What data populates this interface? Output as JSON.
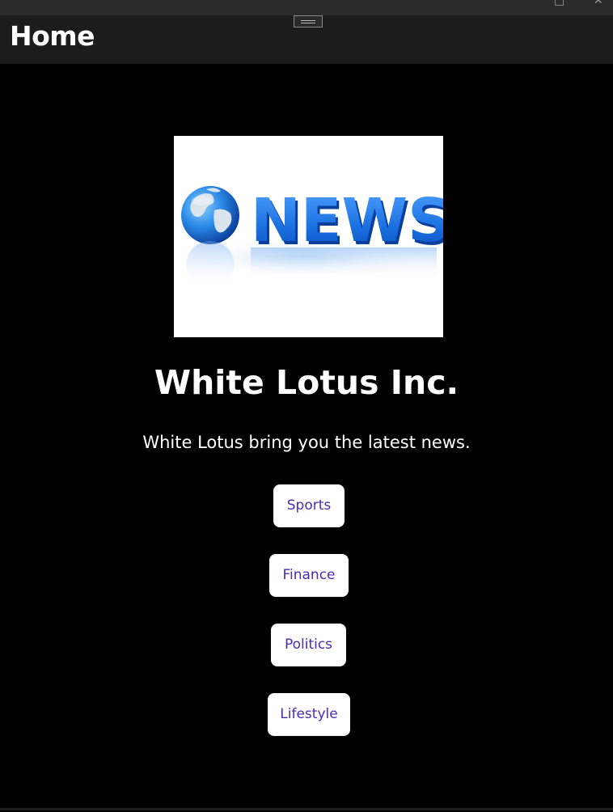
{
  "window": {
    "maximize_icon": "maximize-icon",
    "close_icon": "close-icon",
    "close_glyph": "✕"
  },
  "header": {
    "title": "Home",
    "menu_icon": "hamburger-menu-icon"
  },
  "hero": {
    "image_icon": "news-globe-logo",
    "image_text": "NEWS"
  },
  "main": {
    "brand": "White Lotus Inc.",
    "tagline": "White Lotus bring you the latest news."
  },
  "categories": [
    {
      "label": "Sports"
    },
    {
      "label": "Finance"
    },
    {
      "label": "Politics"
    },
    {
      "label": "Lifestyle"
    }
  ],
  "colors": {
    "background": "#000000",
    "header": "#1c1c1c",
    "button_bg": "#ffffff",
    "button_text": "#4a2bb3",
    "news_blue": "#1a6fe0"
  }
}
